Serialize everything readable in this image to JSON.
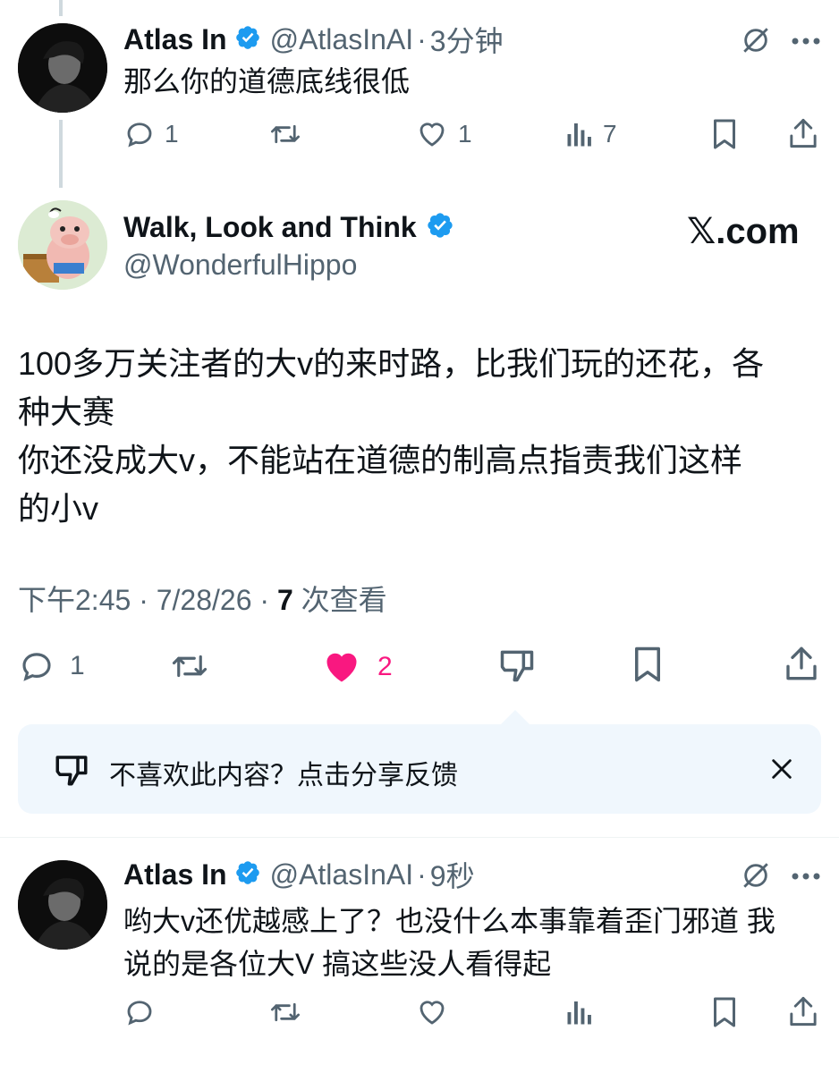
{
  "reply_top": {
    "author_name": "Atlas In",
    "handle": "@AtlasInAI",
    "separator": "·",
    "time": "3分钟",
    "text": "那么你的道德底线很低",
    "replies": "1",
    "likes": "1",
    "views": "7",
    "icons": [
      "grok-icon",
      "more-icon",
      "reply-icon",
      "retweet-icon",
      "heart-icon",
      "views-icon",
      "bookmark-icon",
      "share-icon"
    ]
  },
  "main_tweet": {
    "author_name": "Walk, Look and Think",
    "handle": "@WonderfulHippo",
    "watermark": "𝕏.com",
    "text_lines": [
      "100多万关注者的大v的来时路，比我们玩的还花，各",
      "种大赛",
      "你还没成大v，不能站在道德的制高点指责我们这样",
      "的小v"
    ],
    "time": "下午2:45",
    "sep1": " · ",
    "date": "7/28/26",
    "sep2": " · ",
    "views_count": "7",
    "views_label": " 次查看",
    "replies": "1",
    "likes": "2",
    "like_color": "#f91880"
  },
  "feedback": {
    "text": "不喜欢此内容？点击分享反馈"
  },
  "reply_bottom": {
    "author_name": "Atlas In",
    "handle": "@AtlasInAI",
    "separator": "·",
    "time": "9秒",
    "text_lines": [
      "哟大v还优越感上了？也没什么本事靠着歪门邪道 我",
      "说的是各位大V 搞这些没人看得起"
    ]
  },
  "colors": {
    "verified": "#1d9bf0",
    "secondary_text": "#536471",
    "feedback_bg": "#f0f7fd"
  }
}
